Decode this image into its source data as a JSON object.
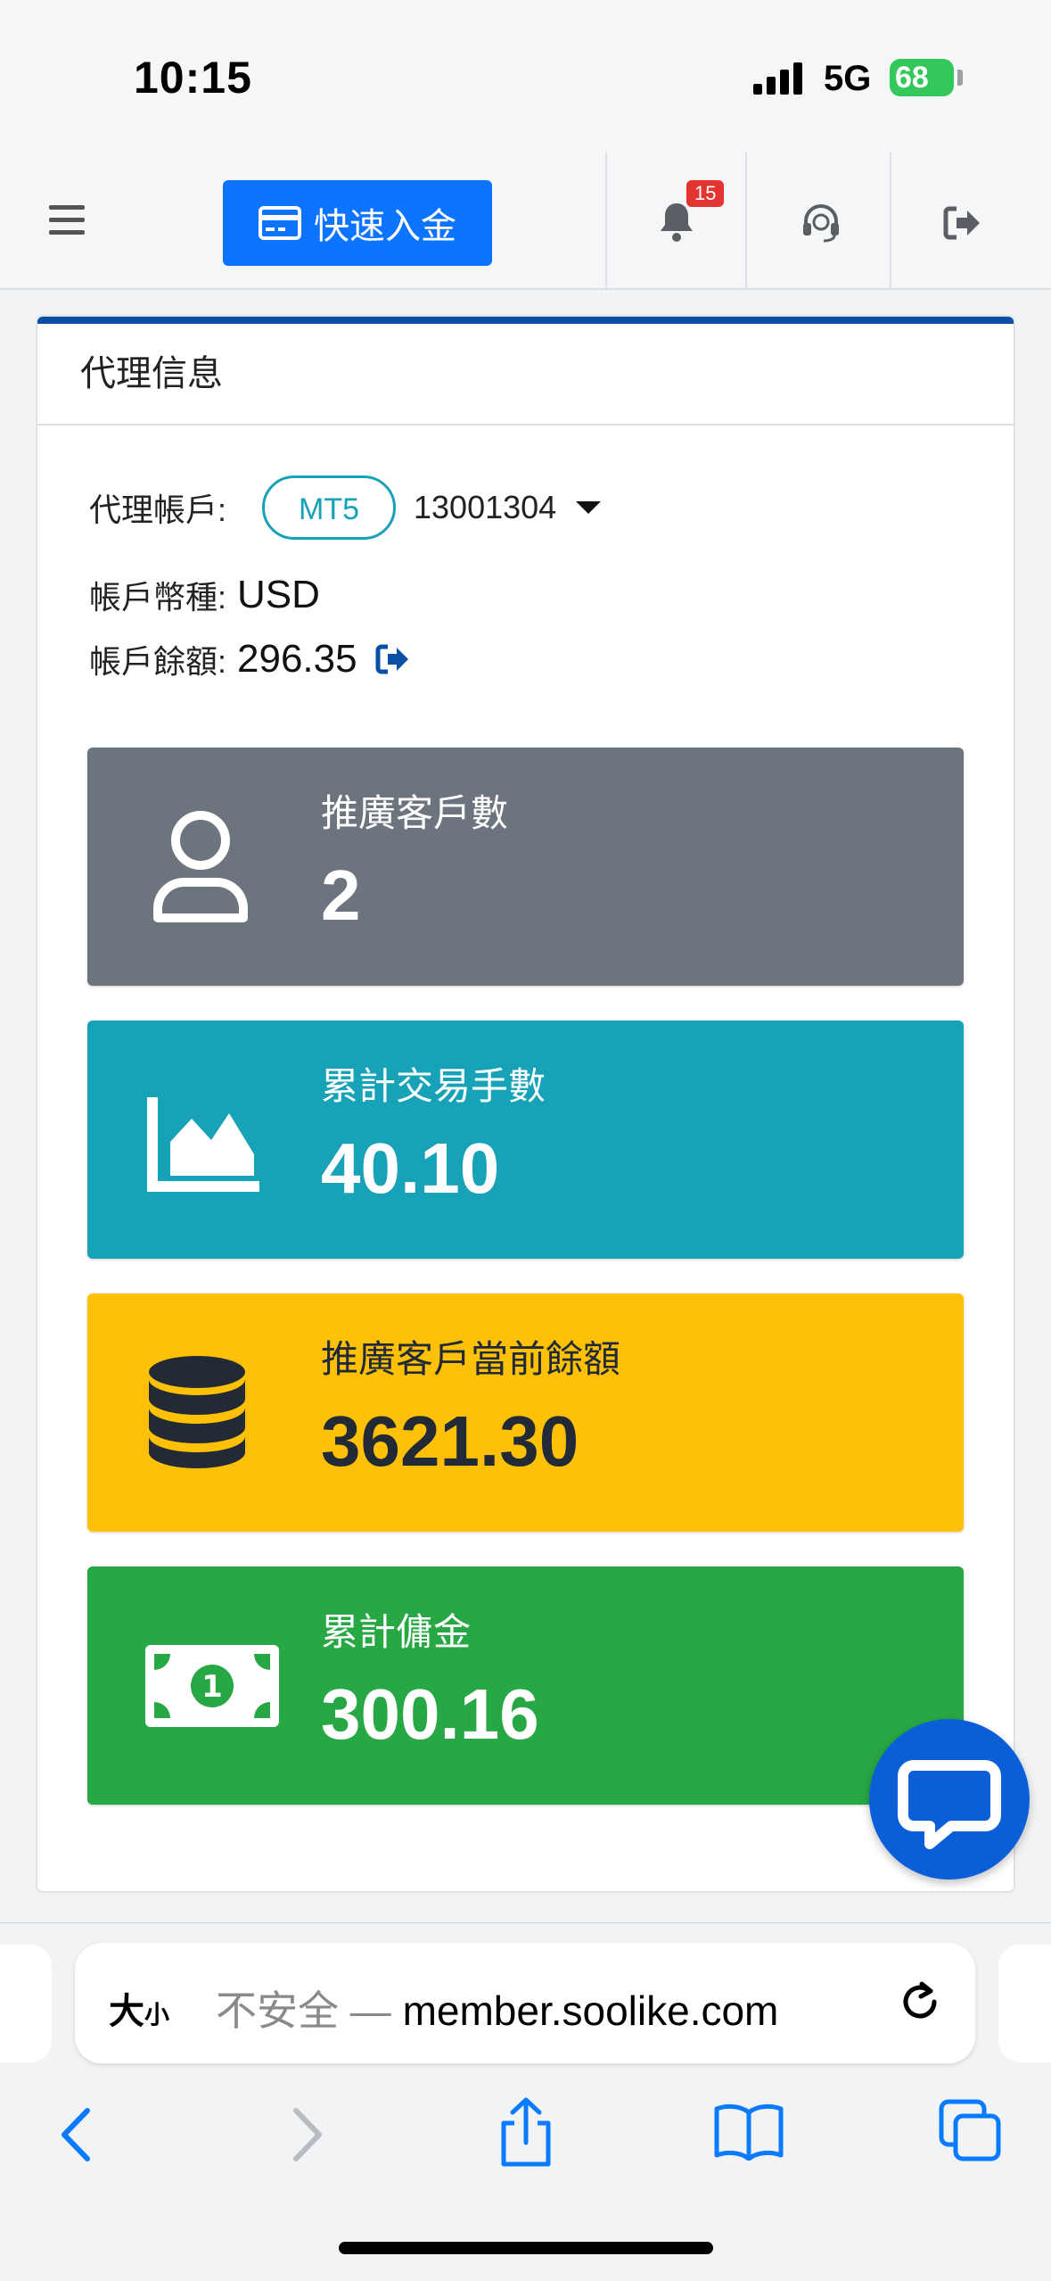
{
  "status_bar": {
    "time": "10:15",
    "network": "5G",
    "battery": "68"
  },
  "top_nav": {
    "deposit_button": "快速入金",
    "notification_count": "15"
  },
  "agent_card": {
    "title": "代理信息",
    "account_label": "代理帳戶:",
    "platform_pill": "MT5",
    "account_number": "13001304",
    "currency_label": "帳戶幣種:",
    "currency_value": "USD",
    "balance_label": "帳戶餘額:",
    "balance_value": "296.35"
  },
  "stats": [
    {
      "label": "推廣客戶數",
      "value": "2",
      "icon": "user-icon",
      "color": "#6c757d"
    },
    {
      "label": "累計交易手數",
      "value": "40.10",
      "icon": "area-chart-icon",
      "color": "#17a2b8"
    },
    {
      "label": "推廣客戶當前餘額",
      "value": "3621.30",
      "icon": "database-icon",
      "color": "#ffc107"
    },
    {
      "label": "累計傭金",
      "value": "300.16",
      "icon": "money-bill-icon",
      "color": "#28a745"
    }
  ],
  "browser": {
    "text_size_label": "大",
    "text_size_small": "小",
    "insecure_label": "不安全 —",
    "domain": "member.soolike.com"
  }
}
